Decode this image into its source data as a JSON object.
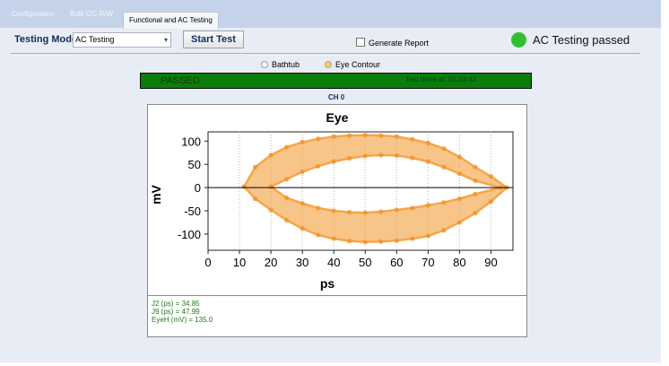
{
  "tabs": [
    {
      "label": "Configuration"
    },
    {
      "label": "Bulk I2C R/W"
    },
    {
      "label": "Functional and AC Testing"
    }
  ],
  "toolbar": {
    "testing_mode_label": "Testing Mode",
    "testing_mode_value": "AC Testing",
    "start_button": "Start Test",
    "generate_report_label": "Generate Report",
    "generate_report_checked": false,
    "status_text": "AC Testing passed",
    "status_color": "#30c02f"
  },
  "view": {
    "options": [
      {
        "label": "Bathtub",
        "selected": false
      },
      {
        "label": "Eye Contour",
        "selected": true
      }
    ]
  },
  "result": {
    "status": "PASSED",
    "test_done": "Test done at: 01:23:42",
    "color": "#0b7d0b"
  },
  "channel": "CH 0",
  "chart_data": {
    "type": "scatter",
    "title": "Eye",
    "xlabel": "ps",
    "ylabel": "mV",
    "xlim": [
      0,
      97
    ],
    "ylim": [
      -135,
      120
    ],
    "xticks": [
      0,
      10,
      20,
      30,
      40,
      50,
      60,
      70,
      80,
      90
    ],
    "yticks": [
      100,
      50,
      0,
      -50,
      -100
    ],
    "grid": "vertical dotted",
    "color": "#f5a64a",
    "series": [
      {
        "x": [
          11.5,
          15,
          20,
          25,
          30,
          35,
          40,
          45,
          50,
          55,
          60,
          65,
          70,
          75,
          80,
          85,
          90,
          95,
          90,
          85,
          80,
          75,
          70,
          65,
          60,
          55,
          50,
          45,
          40,
          35,
          30,
          25,
          20,
          15,
          11.5
        ],
        "y": [
          2,
          44,
          70,
          87,
          98,
          105,
          110,
          112,
          113,
          112,
          110,
          104,
          96,
          84,
          66,
          44,
          24,
          0,
          -30,
          -55,
          -75,
          -92,
          -104,
          -110,
          -114,
          -116,
          -117,
          -115,
          -110,
          -102,
          -88,
          -70,
          -48,
          -24,
          2
        ]
      },
      {
        "x": [
          20,
          25,
          30,
          35,
          40,
          45,
          50,
          55,
          60,
          65,
          70,
          75,
          80,
          85,
          93,
          85,
          80,
          75,
          70,
          65,
          60,
          55,
          50,
          45,
          40,
          35,
          30,
          25,
          20
        ],
        "y": [
          2,
          18,
          34,
          46,
          56,
          63,
          68,
          70,
          69,
          64,
          56,
          44,
          30,
          15,
          0,
          -14,
          -24,
          -32,
          -38,
          -44,
          -48,
          -52,
          -54,
          -53,
          -50,
          -44,
          -34,
          -22,
          2
        ]
      }
    ]
  },
  "metrics": {
    "j2": "J2 (ps) = 34.85",
    "j9": "J9 (ps) = 47.99",
    "eyeh": "EyeH (mV) = 135.0"
  }
}
